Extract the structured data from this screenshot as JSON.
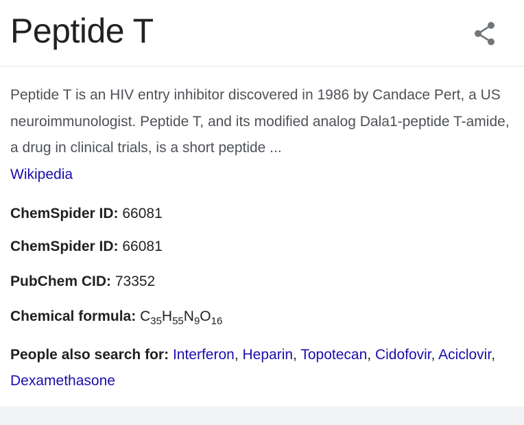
{
  "title": "Peptide T",
  "share_icon": "share-icon",
  "description": {
    "text": "Peptide T is an HIV entry inhibitor discovered in 1986 by Candace Pert, a US neuroimmunologist. Peptide T, and its modified analog Dala1-peptide T-amide, a drug in clinical trials, is a short peptide ...",
    "source_link": "Wikipedia"
  },
  "facts": [
    {
      "label": "ChemSpider ID:",
      "value": "66081"
    },
    {
      "label": "ChemSpider ID:",
      "value": "66081"
    },
    {
      "label": "PubChem CID:",
      "value": "73352"
    }
  ],
  "formula": {
    "label": "Chemical formula:",
    "parts": [
      {
        "el": "C",
        "n": "35"
      },
      {
        "el": "H",
        "n": "55"
      },
      {
        "el": "N",
        "n": "9"
      },
      {
        "el": "O",
        "n": "16"
      }
    ]
  },
  "people_also_search": {
    "label": "People also search for:",
    "items": [
      "Interferon",
      "Heparin",
      "Topotecan",
      "Cidofovir",
      "Aciclovir",
      "Dexamethasone"
    ],
    "separator": ", "
  },
  "colors": {
    "link": "#1a0dab",
    "text": "#202124",
    "muted": "#4d5156",
    "icon": "#70757a"
  }
}
